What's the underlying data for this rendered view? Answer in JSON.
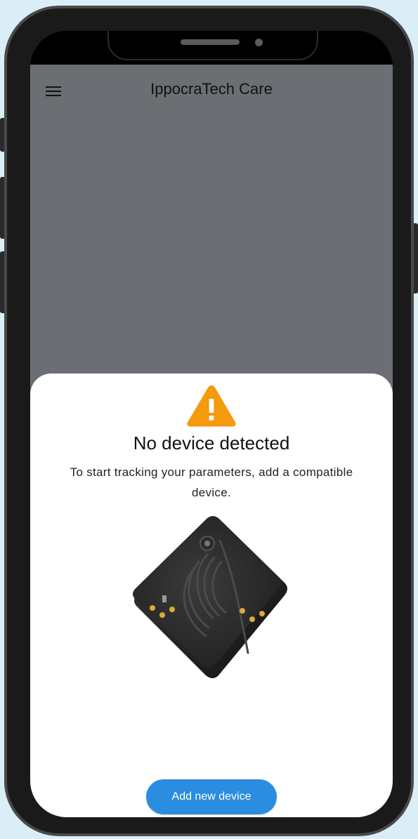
{
  "app": {
    "title": "IppocraTech Care"
  },
  "sheet": {
    "title": "No device detected",
    "subtitle": "To start tracking your parameters, add a compatible device.",
    "add_button_label": "Add new device"
  },
  "colors": {
    "page_background": "#dbeef8",
    "app_background": "#6b6f73",
    "sheet_background": "#ffffff",
    "warning": "#f59a0c",
    "button": "#2b8de0"
  },
  "icons": {
    "menu": "menu-icon",
    "warning": "warning-triangle-icon"
  }
}
